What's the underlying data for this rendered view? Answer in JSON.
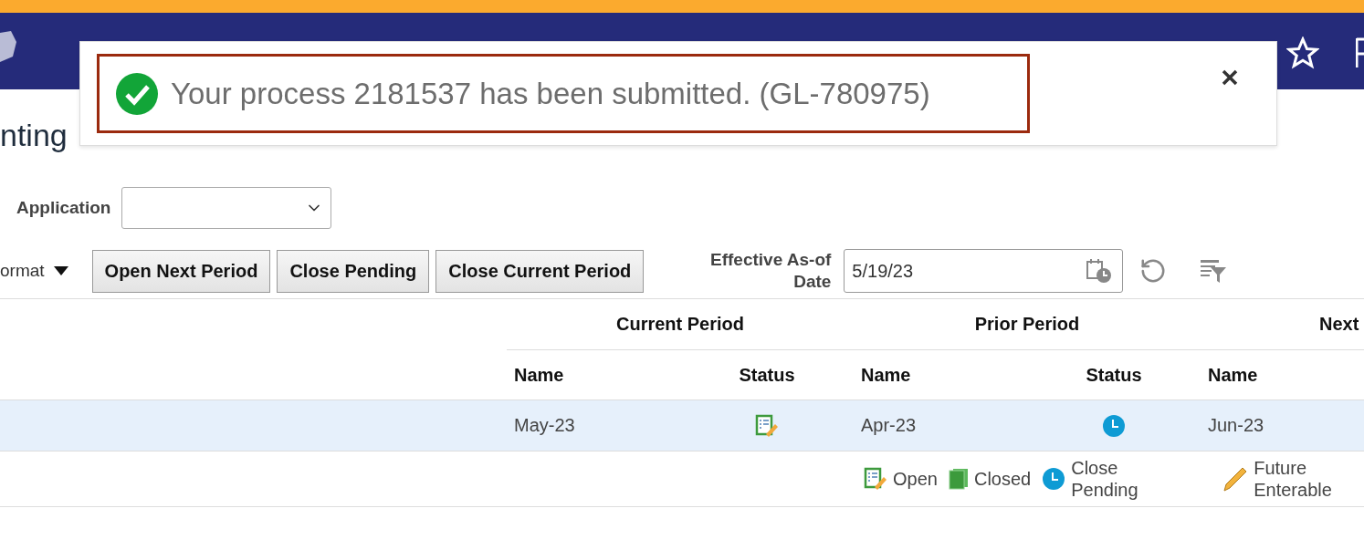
{
  "page_title": "nting",
  "notification": {
    "message": "Your process 2181537 has been submitted. (GL-780975)"
  },
  "application": {
    "label": "Application"
  },
  "toolbar": {
    "menu": "ormat",
    "buttons": [
      "Open Next Period",
      "Close Pending",
      "Close Current Period"
    ]
  },
  "effective_date": {
    "label": "Effective As-of Date",
    "value": "5/19/23"
  },
  "table": {
    "groups": [
      "Current Period",
      "Prior Period",
      "Next"
    ],
    "columns": [
      "Name",
      "Status",
      "Name",
      "Status",
      "Name"
    ],
    "rows": [
      {
        "current_name": "May-23",
        "current_status": {
          "kind": "open"
        },
        "prior_name": "Apr-23",
        "prior_status": {
          "kind": "close_pending"
        },
        "next_name": "Jun-23",
        "selected": true
      }
    ]
  },
  "legend": [
    {
      "kind": "open",
      "label": "Open"
    },
    {
      "kind": "closed",
      "label": "Closed"
    },
    {
      "kind": "close_pending",
      "label": "Close Pending"
    },
    {
      "kind": "future_enterable",
      "label": "Future Enterable"
    }
  ]
}
